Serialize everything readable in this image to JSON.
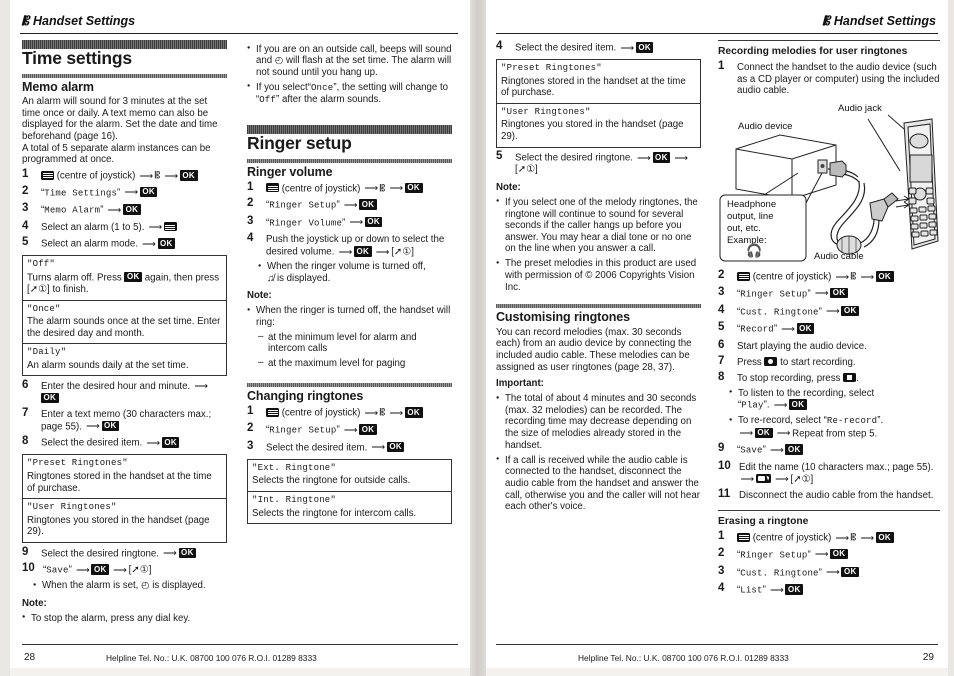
{
  "header": {
    "left_title": "Handset Settings",
    "right_title": "Handset Settings",
    "tool_icon": "pencil-icon"
  },
  "footer": {
    "left_page": "28",
    "right_page": "29",
    "helpline": "Helpline Tel. No.: U.K. 08700 100 076  R.O.I. 01289 8333"
  },
  "column1": {
    "section_title": "Time settings",
    "sub_title": "Memo alarm",
    "intro": "An alarm will sound for 3 minutes at the set time once or daily. A text memo can also be displayed for the alarm. Set the date and time beforehand (page 16).",
    "intro2": "A total of 5 separate alarm instances can be programmed at once.",
    "steps": [
      {
        "n": "1",
        "pre": "",
        "key": "joystick-centre",
        "text": "(centre of joystick)",
        "tail": ""
      },
      {
        "n": "2",
        "quoted": "Time Settings"
      },
      {
        "n": "3",
        "quoted": "Memo Alarm"
      },
      {
        "n": "4",
        "text": "Select an alarm (1 to 5)."
      },
      {
        "n": "5",
        "text": "Select an alarm mode."
      }
    ],
    "mode_table": [
      {
        "label": "\"Off\"",
        "desc_a": "Turns alarm off. Press",
        "desc_b": "again, then press",
        "desc_c": "to finish."
      },
      {
        "label": "\"Once\"",
        "desc": "The alarm sounds once at the set time. Enter the desired day and month."
      },
      {
        "label": "\"Daily\"",
        "desc": "An alarm sounds daily at the set time."
      }
    ],
    "steps2": [
      {
        "n": "6",
        "text": "Enter the desired hour and minute."
      },
      {
        "n": "7",
        "text": "Enter a text memo (30 characters max.; page 55)."
      },
      {
        "n": "8",
        "text": "Select the desired item."
      }
    ],
    "ringtone_table": [
      {
        "label": "\"Preset Ringtones\"",
        "desc": "Ringtones stored in the handset at the time of purchase."
      },
      {
        "label": "\"User Ringtones\"",
        "desc": "Ringtones you stored in the handset (page 29)."
      }
    ],
    "steps3": [
      {
        "n": "9",
        "text": "Select the desired ringtone."
      },
      {
        "n": "10",
        "quoted": "Save"
      }
    ],
    "step10_bullet": "When the alarm is set,  is displayed.",
    "step10_bullet_a": "When the alarm is set,",
    "step10_bullet_b": "is displayed.",
    "note_label": "Note:",
    "note_bullet": "To stop the alarm, press any dial key."
  },
  "column2": {
    "top_bullets": [
      {
        "a": "If you are on an outside call, beeps will sound and",
        "b": "will flash at the set time. The alarm will not sound until you hang up."
      },
      {
        "a": "If you select",
        "q1": "Once",
        "b": ", the setting will change to",
        "q2": "Off",
        "c": "after the alarm sounds."
      }
    ],
    "section_title": "Ringer setup",
    "sub_title": "Ringer volume",
    "steps": [
      {
        "n": "1",
        "text": "(centre of joystick)"
      },
      {
        "n": "2",
        "quoted": "Ringer Setup"
      },
      {
        "n": "3",
        "quoted": "Ringer Volume"
      },
      {
        "n": "4",
        "text": "Push the joystick up or down to select the desired volume."
      }
    ],
    "step4_bullet_a": "When the ringer volume is turned off,",
    "step4_bullet_b": "is displayed.",
    "note_label": "Note:",
    "note_bullet": "When the ringer is turned off, the handset will ring:",
    "note_dashes": [
      "at the minimum level for alarm and intercom calls",
      "at the maximum level for paging"
    ],
    "sub_title2": "Changing ringtones",
    "steps2": [
      {
        "n": "1",
        "text": "(centre of joystick)"
      },
      {
        "n": "2",
        "quoted": "Ringer Setup"
      },
      {
        "n": "3",
        "text": "Select the desired item."
      }
    ],
    "ringtone_table": [
      {
        "label": "\"Ext. Ringtone\"",
        "desc": "Selects the ringtone for outside calls."
      },
      {
        "label": "\"Int. Ringtone\"",
        "desc": "Selects the ringtone for intercom calls."
      }
    ]
  },
  "column3": {
    "step4": {
      "n": "4",
      "text": "Select the desired item."
    },
    "ringtone_table": [
      {
        "label": "\"Preset Ringtones\"",
        "desc": "Ringtones stored in the handset at the time of purchase."
      },
      {
        "label": "\"User Ringtones\"",
        "desc": "Ringtones you stored in the handset (page 29)."
      }
    ],
    "step5": {
      "n": "5",
      "text": "Select the desired ringtone."
    },
    "note_label": "Note:",
    "note_bullets": [
      "If you select one of the melody ringtones, the ringtone will continue to sound for several seconds if the caller hangs up before you answer. You may hear a dial tone or no one on the line when you answer a call.",
      "The preset melodies in this product are used with permission of © 2006 Copyrights Vision Inc."
    ],
    "sub_title": "Customising ringtones",
    "intro": "You can record melodies (max. 30 seconds each) from an audio device by connecting the included audio cable. These melodies can be assigned as user ringtones (page 28, 37).",
    "important_label": "Important:",
    "important_bullets": [
      "The total of about 4 minutes and 30 seconds (max. 32 melodies) can be recorded. The recording time may decrease depending on the size of melodies already stored in the handset.",
      "If a call is received while the audio cable is connected to the handset, disconnect the audio cable from the handset and answer the call, otherwise you and the caller will not hear each other's voice."
    ]
  },
  "column4": {
    "sub_title": "Recording melodies for user ringtones",
    "step1": {
      "n": "1",
      "text": "Connect the handset to the audio device (such as a CD player or computer) using the included audio cable."
    },
    "figure": {
      "label_audio_device": "Audio device",
      "label_audio_jack": "Audio jack",
      "label_audio_cable": "Audio cable",
      "callout_line1": "Headphone",
      "callout_line2": "output, line",
      "callout_line3": "out, etc.",
      "callout_line4": "Example:",
      "callout_icon": "headphone-icon"
    },
    "steps": [
      {
        "n": "2",
        "text": "(centre of joystick)"
      },
      {
        "n": "3",
        "quoted": "Ringer Setup"
      },
      {
        "n": "4",
        "quoted": "Cust. Ringtone"
      },
      {
        "n": "5",
        "quoted": "Record"
      },
      {
        "n": "6",
        "text": "Start playing the audio device."
      },
      {
        "n": "7",
        "text_a": "Press",
        "text_b": "to start recording."
      },
      {
        "n": "8",
        "text_a": "To stop recording, press",
        "text_b": "."
      }
    ],
    "step8_bullets": [
      {
        "a": "To listen to the recording, select",
        "q": "Play",
        "b": "."
      },
      {
        "a": "To re-record, select",
        "q": "Re-record",
        "b": ".",
        "c": "Repeat from step 5."
      }
    ],
    "steps2": [
      {
        "n": "9",
        "quoted": "Save"
      },
      {
        "n": "10",
        "text": "Edit the name (10 characters max.; page 55)."
      },
      {
        "n": "11",
        "text": "Disconnect the audio cable from the handset."
      }
    ],
    "erase_title": "Erasing a ringtone",
    "erase_steps": [
      {
        "n": "1",
        "text": "(centre of joystick)"
      },
      {
        "n": "2",
        "quoted": "Ringer Setup"
      },
      {
        "n": "3",
        "quoted": "Cust. Ringtone"
      },
      {
        "n": "4",
        "quoted": "List"
      }
    ]
  },
  "keys": {
    "ok": "OK",
    "offhook": "[ ]"
  }
}
